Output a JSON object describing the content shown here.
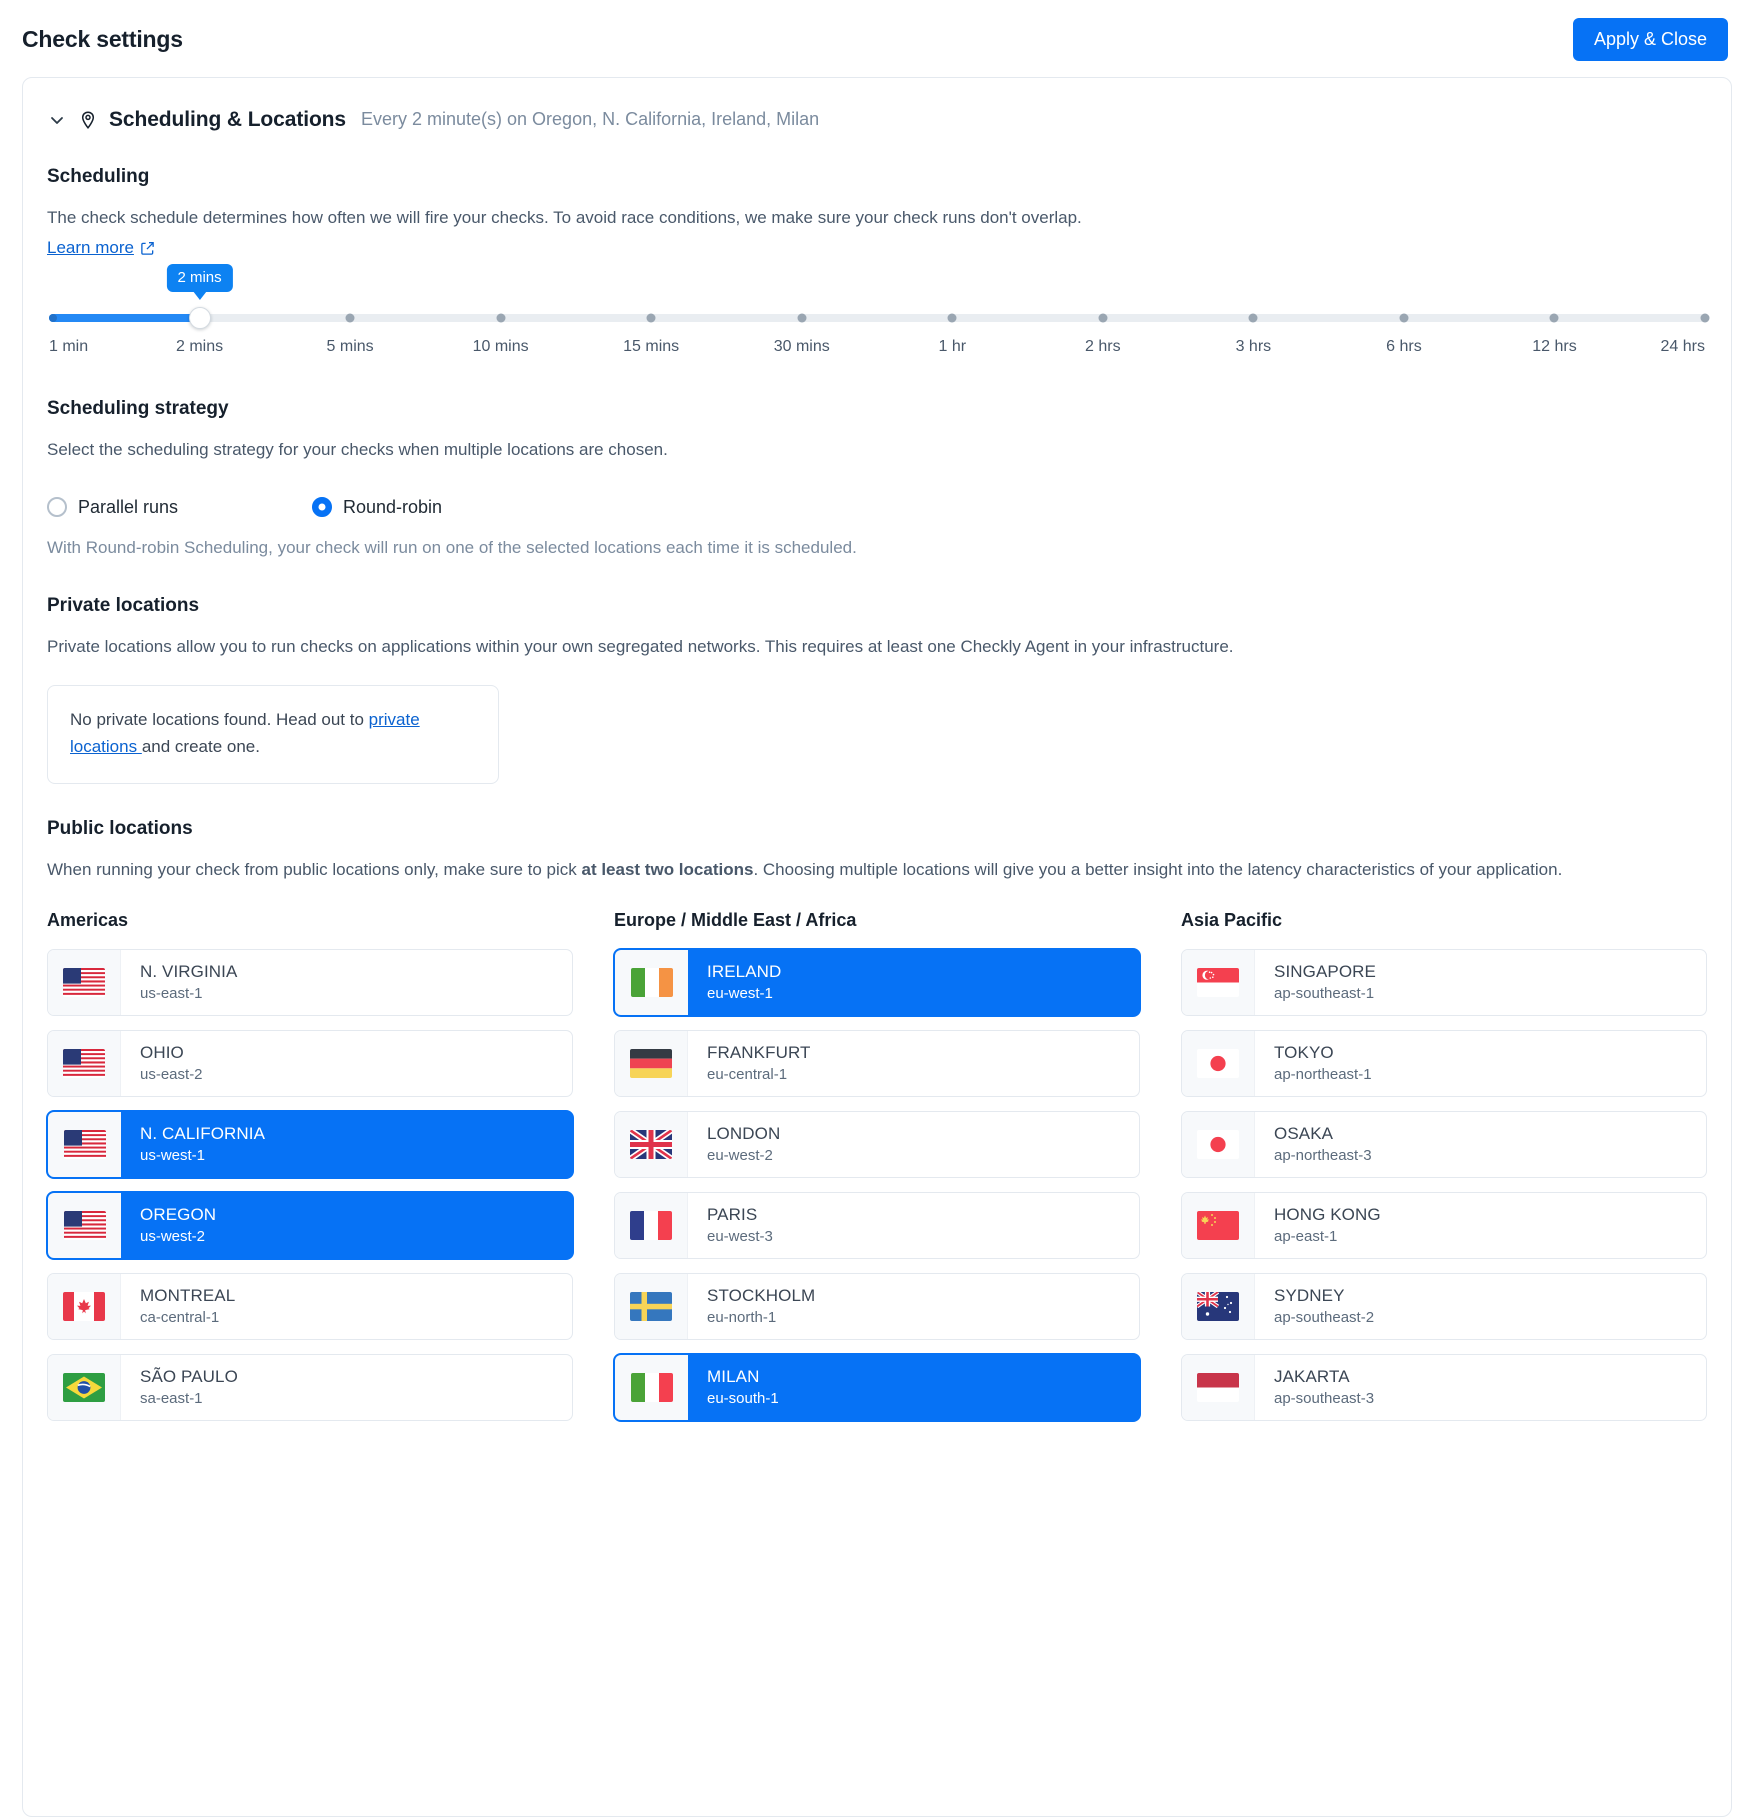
{
  "header": {
    "title": "Check settings",
    "apply_label": "Apply & Close"
  },
  "panel": {
    "title": "Scheduling & Locations",
    "summary": "Every 2 minute(s) on Oregon, N. California, Ireland, Milan"
  },
  "scheduling": {
    "title": "Scheduling",
    "description": "The check schedule determines how often we will fire your checks. To avoid race conditions, we make sure your check runs don't overlap.",
    "learn_more": "Learn more",
    "slider": {
      "value_label": "2 mins",
      "selected_index": 1,
      "ticks": [
        "1 min",
        "2 mins",
        "5 mins",
        "10 mins",
        "15 mins",
        "30 mins",
        "1 hr",
        "2 hrs",
        "3 hrs",
        "6 hrs",
        "12 hrs",
        "24 hrs"
      ]
    }
  },
  "strategy": {
    "title": "Scheduling strategy",
    "description": "Select the scheduling strategy for your checks when multiple locations are chosen.",
    "options": [
      {
        "label": "Parallel runs",
        "selected": false
      },
      {
        "label": "Round-robin",
        "selected": true
      }
    ],
    "note": "With Round-robin Scheduling, your check will run on one of the selected locations each time it is scheduled."
  },
  "private_locations": {
    "title": "Private locations",
    "description": "Private locations allow you to run checks on applications within your own segregated networks. This requires at least one Checkly Agent in your infrastructure.",
    "empty_prefix": "No private locations found. Head out to ",
    "empty_link": "private locations ",
    "empty_suffix": "and create one."
  },
  "public_locations": {
    "title": "Public locations",
    "description_pre": "When running your check from public locations only, make sure to pick ",
    "description_bold": "at least two locations",
    "description_post": ". Choosing multiple locations will give you a better insight into the latency characteristics of your application.",
    "columns": [
      {
        "title": "Americas",
        "items": [
          {
            "name": "N. VIRGINIA",
            "region": "us-east-1",
            "flag": "us-flag",
            "selected": false
          },
          {
            "name": "OHIO",
            "region": "us-east-2",
            "flag": "us-flag",
            "selected": false
          },
          {
            "name": "N. CALIFORNIA",
            "region": "us-west-1",
            "flag": "us-flag",
            "selected": true
          },
          {
            "name": "OREGON",
            "region": "us-west-2",
            "flag": "us-flag",
            "selected": true
          },
          {
            "name": "MONTREAL",
            "region": "ca-central-1",
            "flag": "ca-flag",
            "selected": false
          },
          {
            "name": "SÃO PAULO",
            "region": "sa-east-1",
            "flag": "br-flag",
            "selected": false
          }
        ]
      },
      {
        "title": "Europe / Middle East / Africa",
        "items": [
          {
            "name": "IRELAND",
            "region": "eu-west-1",
            "flag": "ie-flag",
            "selected": true
          },
          {
            "name": "FRANKFURT",
            "region": "eu-central-1",
            "flag": "de-flag",
            "selected": false
          },
          {
            "name": "LONDON",
            "region": "eu-west-2",
            "flag": "gb-flag",
            "selected": false
          },
          {
            "name": "PARIS",
            "region": "eu-west-3",
            "flag": "fr-flag",
            "selected": false
          },
          {
            "name": "STOCKHOLM",
            "region": "eu-north-1",
            "flag": "se-flag",
            "selected": false
          },
          {
            "name": "MILAN",
            "region": "eu-south-1",
            "flag": "it-flag",
            "selected": true
          }
        ]
      },
      {
        "title": "Asia Pacific",
        "items": [
          {
            "name": "SINGAPORE",
            "region": "ap-southeast-1",
            "flag": "sg-flag",
            "selected": false
          },
          {
            "name": "TOKYO",
            "region": "ap-northeast-1",
            "flag": "jp-flag",
            "selected": false
          },
          {
            "name": "OSAKA",
            "region": "ap-northeast-3",
            "flag": "jp-flag",
            "selected": false
          },
          {
            "name": "HONG KONG",
            "region": "ap-east-1",
            "flag": "cn-flag",
            "selected": false
          },
          {
            "name": "SYDNEY",
            "region": "ap-southeast-2",
            "flag": "au-flag",
            "selected": false
          },
          {
            "name": "JAKARTA",
            "region": "ap-southeast-3",
            "flag": "id-flag",
            "selected": false
          }
        ]
      }
    ]
  },
  "colors": {
    "accent": "#0672f5",
    "slider_fill": "#2489f5",
    "link": "#0a62d0"
  }
}
